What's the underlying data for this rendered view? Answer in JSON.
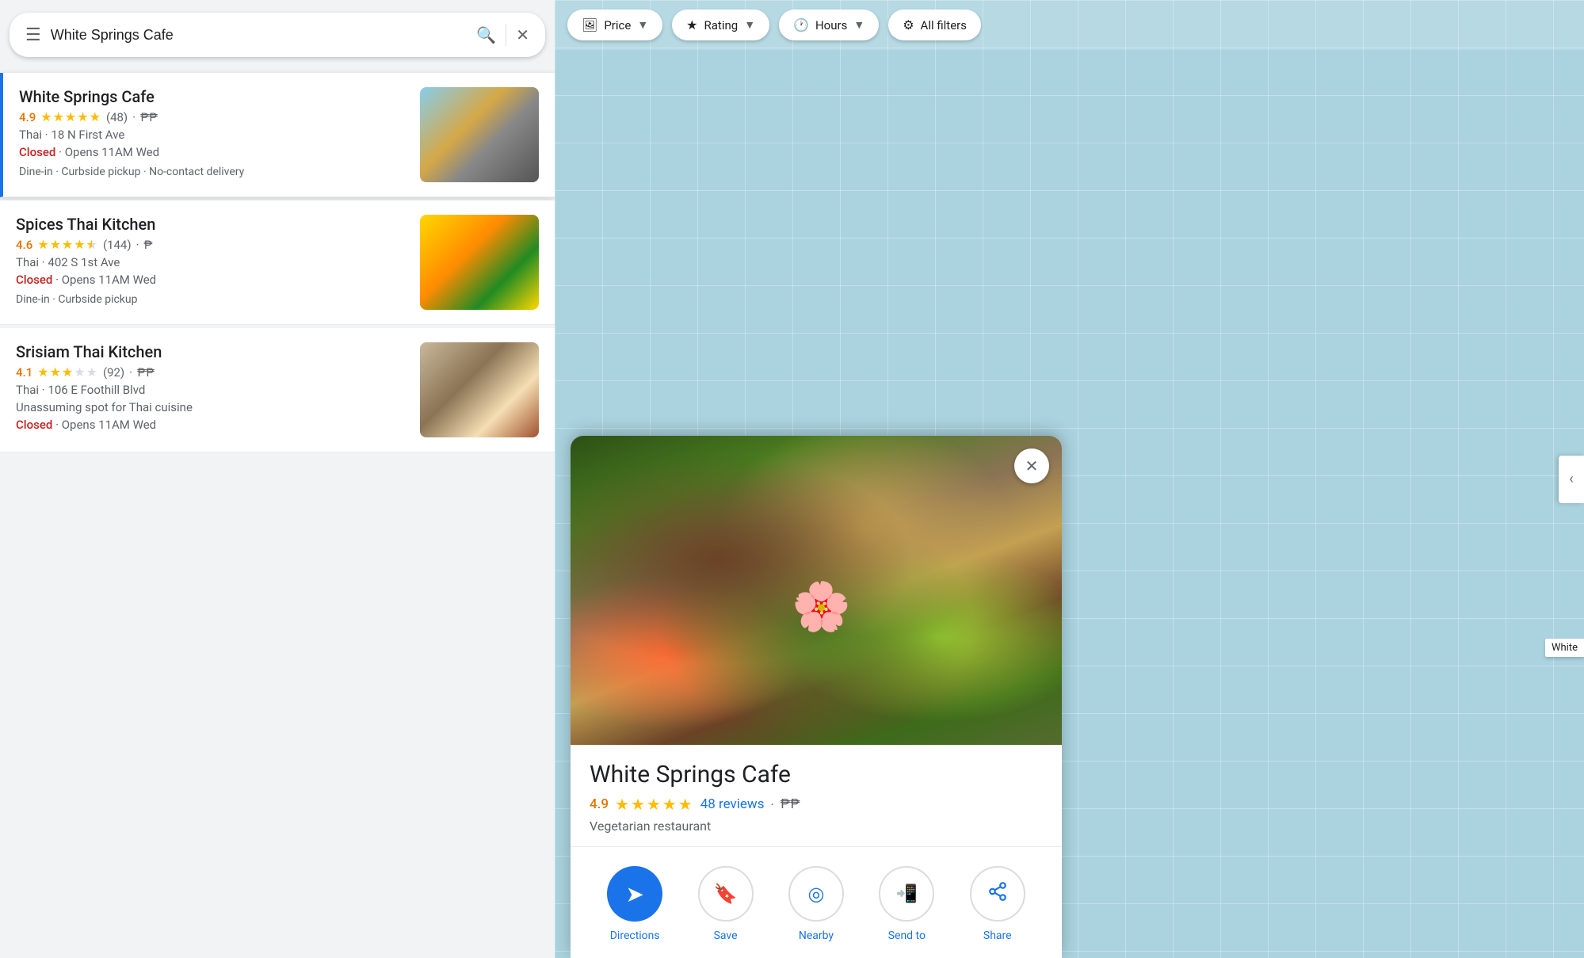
{
  "search": {
    "placeholder": "White Springs Cafe",
    "value": "White Springs Cafe"
  },
  "filters": [
    {
      "id": "price",
      "icon": "🖼",
      "label": "Price",
      "hasArrow": true
    },
    {
      "id": "rating",
      "icon": "★",
      "label": "Rating",
      "hasArrow": true
    },
    {
      "id": "hours",
      "icon": "🕐",
      "label": "Hours",
      "hasArrow": true
    },
    {
      "id": "all-filters",
      "icon": "⚙",
      "label": "All filters",
      "hasArrow": false
    }
  ],
  "results": [
    {
      "id": "white-springs",
      "name": "White Springs Cafe",
      "rating": "4.9",
      "stars": "★★★★★",
      "reviews": "(48)",
      "price": "₱₱",
      "cuisine": "Thai",
      "address": "18 N First Ave",
      "status": "Closed",
      "hours": "Opens 11AM Wed",
      "services": "Dine-in · Curbside pickup · No-contact delivery",
      "selected": true,
      "imgClass": "img-white-springs"
    },
    {
      "id": "spices-thai",
      "name": "Spices Thai Kitchen",
      "rating": "4.6",
      "stars": "★★★★",
      "halfStar": true,
      "reviews": "(144)",
      "price": "₱",
      "cuisine": "Thai",
      "address": "402 S 1st Ave",
      "status": "Closed",
      "hours": "Opens 11AM Wed",
      "services": "Dine-in · Curbside pickup",
      "selected": false,
      "imgClass": "img-spices"
    },
    {
      "id": "srisiam",
      "name": "Srisiam Thai Kitchen",
      "rating": "4.1",
      "stars": "★★★",
      "halfStarGray": true,
      "reviews": "(92)",
      "price": "₱₱",
      "cuisine": "Thai",
      "address": "106 E Foothill Blvd",
      "description": "Unassuming spot for Thai cuisine",
      "status": "Closed",
      "hours": "Opens 11AM Wed",
      "services": "",
      "selected": false,
      "imgClass": "img-srisiam"
    }
  ],
  "detail": {
    "name": "White Springs Cafe",
    "rating": "4.9",
    "stars": "★★★★★",
    "reviews_label": "48 reviews",
    "price": "₱₱",
    "type": "Vegetarian restaurant",
    "actions": [
      {
        "id": "directions",
        "icon": "➤",
        "label": "Directions",
        "filled": true
      },
      {
        "id": "save",
        "icon": "🔖",
        "label": "Save",
        "filled": false
      },
      {
        "id": "nearby",
        "icon": "◎",
        "label": "Nearby",
        "filled": false
      },
      {
        "id": "send-to",
        "icon": "📲",
        "label": "Send to",
        "filled": false
      },
      {
        "id": "share",
        "icon": "↗",
        "label": "Share",
        "filled": false
      }
    ]
  },
  "edge": {
    "label": "White"
  }
}
